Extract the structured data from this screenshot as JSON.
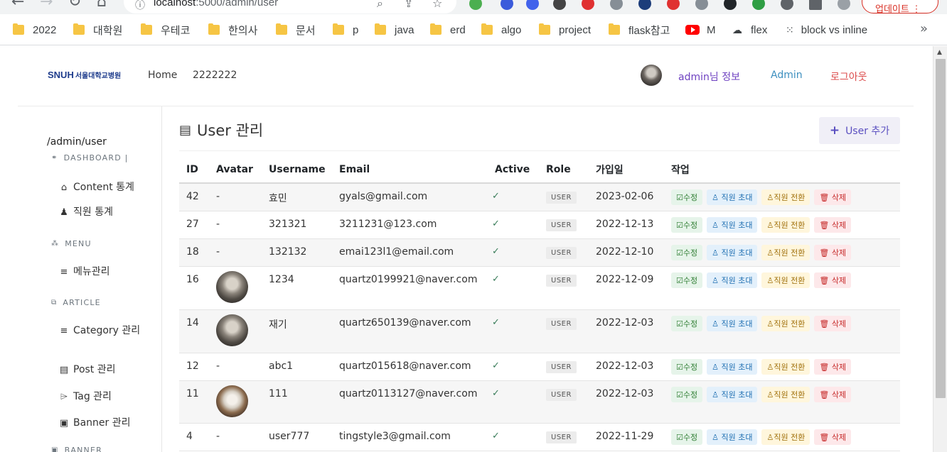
{
  "browser": {
    "url_host": "localhost",
    "url_rest": ":5000/admin/user",
    "update_label": "업데이트",
    "update_dots": "⋮",
    "bookmarks": [
      {
        "label": "2022",
        "icon": "folder-icon"
      },
      {
        "label": "대학원",
        "icon": "folder-icon"
      },
      {
        "label": "우테코",
        "icon": "folder-icon"
      },
      {
        "label": "한의사",
        "icon": "folder-icon"
      },
      {
        "label": "문서",
        "icon": "folder-icon"
      },
      {
        "label": "p",
        "icon": "folder-icon"
      },
      {
        "label": "java",
        "icon": "folder-icon"
      },
      {
        "label": "erd",
        "icon": "folder-icon"
      },
      {
        "label": "algo",
        "icon": "folder-icon"
      },
      {
        "label": "project",
        "icon": "folder-icon"
      },
      {
        "label": "flask참고",
        "icon": "folder-icon"
      },
      {
        "label": "M",
        "icon": "youtube-icon"
      },
      {
        "label": "flex",
        "icon": "cloud-icon"
      },
      {
        "label": "block vs inline",
        "icon": "dots-icon"
      }
    ],
    "more_bookmarks": "»"
  },
  "header": {
    "brand": "SNUH",
    "brand_kr": "서울대학교병원",
    "nav": {
      "home": "Home",
      "second": "2222222"
    },
    "user_info": "admin님 정보",
    "admin": "Admin",
    "logout": "로그아웃",
    "colors": {
      "user_info": "#6f42c1",
      "admin": "#3d8fbf",
      "logout": "#dc4d4d"
    }
  },
  "sidebar": {
    "path": "/admin/user",
    "sections": {
      "dashboard": "DASHBOARD |",
      "menu": "MENU",
      "article": "ARTICLE",
      "banner": "BANNER"
    },
    "items": {
      "content_stats": "Content 통계",
      "staff_stats": "직원 통계",
      "menu_manage": "메뉴관리",
      "category_manage": "Category 관리",
      "post_manage": "Post 관리",
      "tag_manage": "Tag 관리",
      "banner_manage": "Banner 관리"
    }
  },
  "main": {
    "title": "User 관리",
    "add_button": "User 추가",
    "columns": [
      "ID",
      "Avatar",
      "Username",
      "Email",
      "Active",
      "Role",
      "가입일",
      "작업"
    ],
    "actions": {
      "edit": "수정",
      "invite": "직원 초대",
      "convert": "직원 전환",
      "delete": "삭제"
    },
    "rows": [
      {
        "id": "42",
        "avatar": "-",
        "username": "효민",
        "email": "gyals@gmail.com",
        "active": "✓",
        "role": "USER",
        "joined": "2023-02-06"
      },
      {
        "id": "27",
        "avatar": "-",
        "username": "321321",
        "email": "3211231@123.com",
        "active": "✓",
        "role": "USER",
        "joined": "2022-12-13"
      },
      {
        "id": "18",
        "avatar": "-",
        "username": "132132",
        "email": "emai123l1@email.com",
        "active": "✓",
        "role": "USER",
        "joined": "2022-12-10"
      },
      {
        "id": "16",
        "avatar": "",
        "username": "1234",
        "email": "quartz0199921@naver.com",
        "active": "✓",
        "role": "USER",
        "joined": "2022-12-09"
      },
      {
        "id": "14",
        "avatar": "",
        "username": "재기",
        "email": "quartz650139@naver.com",
        "active": "✓",
        "role": "USER",
        "joined": "2022-12-03"
      },
      {
        "id": "12",
        "avatar": "-",
        "username": "abc1",
        "email": "quartz015618@naver.com",
        "active": "✓",
        "role": "USER",
        "joined": "2022-12-03"
      },
      {
        "id": "11",
        "avatar": "",
        "username": "111",
        "email": "quartz0113127@naver.com",
        "active": "✓",
        "role": "USER",
        "joined": "2022-12-03"
      },
      {
        "id": "4",
        "avatar": "-",
        "username": "user777",
        "email": "tingstyle3@gmail.com",
        "active": "✓",
        "role": "USER",
        "joined": "2022-11-29"
      }
    ]
  }
}
